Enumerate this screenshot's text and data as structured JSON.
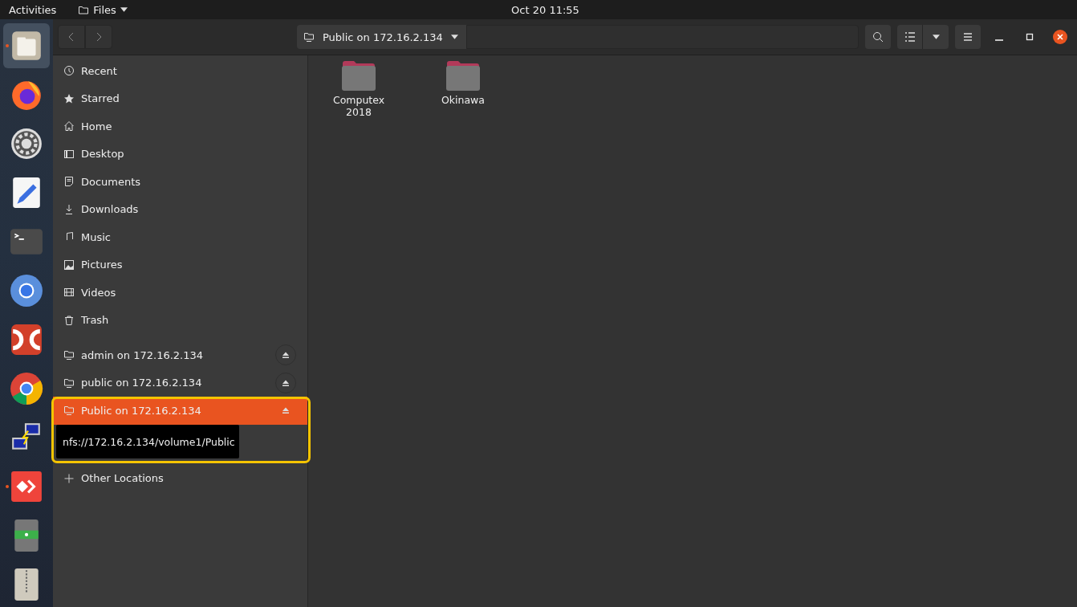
{
  "top_bar": {
    "activities": "Activities",
    "app_menu": "Files",
    "clock": "Oct 20  11:55"
  },
  "dock": [
    {
      "kind": "files",
      "running": true,
      "selected": true
    },
    {
      "kind": "firefox",
      "running": false,
      "selected": false
    },
    {
      "kind": "settings",
      "running": false,
      "selected": false
    },
    {
      "kind": "editor",
      "running": false,
      "selected": false
    },
    {
      "kind": "terminal",
      "running": false,
      "selected": false
    },
    {
      "kind": "chromium",
      "running": false,
      "selected": false
    },
    {
      "kind": "doublecmd",
      "running": false,
      "selected": false
    },
    {
      "kind": "chrome",
      "running": false,
      "selected": false
    },
    {
      "kind": "network",
      "running": false,
      "selected": false
    },
    {
      "kind": "anydesk",
      "running": true,
      "selected": false
    },
    {
      "kind": "notes",
      "running": false,
      "selected": false
    },
    {
      "kind": "archive",
      "running": false,
      "selected": false
    }
  ],
  "header": {
    "location": "Public on 172.16.2.134"
  },
  "sidebar": {
    "places": [
      {
        "kind": "recent",
        "label": "Recent"
      },
      {
        "kind": "starred",
        "label": "Starred"
      },
      {
        "kind": "home",
        "label": "Home"
      },
      {
        "kind": "desktop",
        "label": "Desktop"
      },
      {
        "kind": "documents",
        "label": "Documents"
      },
      {
        "kind": "downloads",
        "label": "Downloads"
      },
      {
        "kind": "music",
        "label": "Music"
      },
      {
        "kind": "pictures",
        "label": "Pictures"
      },
      {
        "kind": "videos",
        "label": "Videos"
      },
      {
        "kind": "trash",
        "label": "Trash"
      }
    ],
    "mounts": [
      {
        "label": "admin on 172.16.2.134",
        "selected": false
      },
      {
        "label": "public on 172.16.2.134",
        "selected": false
      },
      {
        "label": "Public on 172.16.2.134",
        "selected": true
      }
    ],
    "tooltip": "nfs://172.16.2.134/volume1/Public",
    "other": "Other Locations"
  },
  "folders": [
    {
      "name": "Computex 2018"
    },
    {
      "name": "Okinawa"
    }
  ]
}
